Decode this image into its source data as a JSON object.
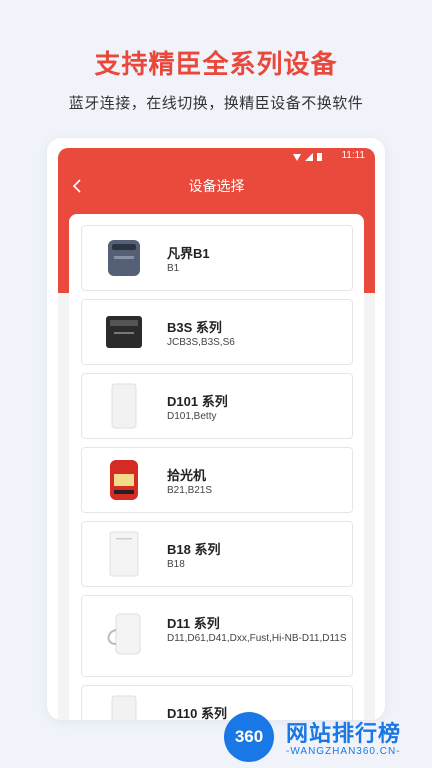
{
  "promo": {
    "headline": "支持精臣全系列设备",
    "subline": "蓝牙连接，在线切换，换精臣设备不换软件"
  },
  "statusbar": {
    "time": "11:11",
    "icons": [
      "wifi-icon",
      "signal-icon",
      "battery-icon"
    ]
  },
  "header": {
    "title": "设备选择",
    "back_icon": "chevron-left-icon"
  },
  "devices": [
    {
      "name": "凡界B1",
      "models": "B1",
      "thumb": "gray-printer"
    },
    {
      "name": "B3S 系列",
      "models": "JCB3S,B3S,S6",
      "thumb": "black-printer"
    },
    {
      "name": "D101 系列",
      "models": "D101,Betty",
      "thumb": "white-printer"
    },
    {
      "name": "拾光机",
      "models": "B21,B21S",
      "thumb": "red-printer"
    },
    {
      "name": "B18 系列",
      "models": "B18",
      "thumb": "white-printer"
    },
    {
      "name": "D11 系列",
      "models": "D11,D61,D41,Dxx,Fust,Hi-NB-D11,D11S",
      "thumb": "white-printer-strap"
    },
    {
      "name": "D110 系列",
      "models": "",
      "thumb": "white-printer"
    }
  ],
  "watermark": {
    "badge": "360",
    "title": "网站排行榜",
    "url": "-WANGZHAN360.CN-"
  },
  "colors": {
    "accent": "#e9483a",
    "header_red": "#ea4a3b",
    "watermark_blue": "#1a78e6"
  }
}
